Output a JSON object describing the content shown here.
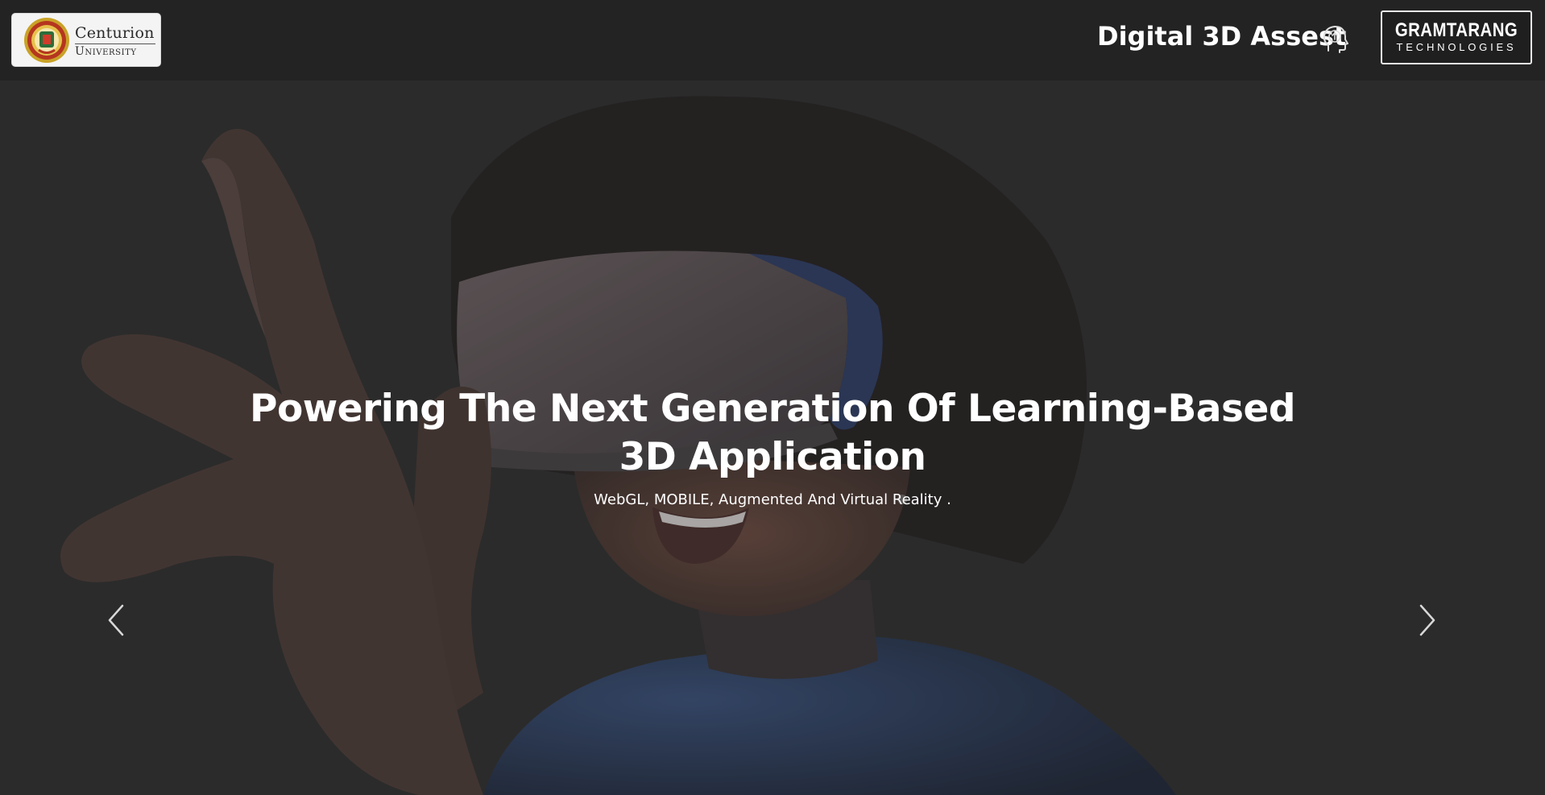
{
  "header": {
    "left_logo": {
      "name_line1": "Centurion",
      "name_line2": "University"
    },
    "site_title": "Digital 3D Assest",
    "title_icon": "head-upload-icon",
    "right_logo": {
      "name_line1": "GRAMTARANG",
      "name_line2": "TECHNOLOGIES"
    }
  },
  "hero": {
    "title": "Powering The Next Generation Of Learning-Based 3D Application",
    "subtitle": "WebGL, MOBILE, Augmented And Virtual Reality .",
    "prev_icon": "chevron-left-icon",
    "next_icon": "chevron-right-icon"
  },
  "colors": {
    "header_bg": "#232323",
    "hero_bg": "#2e2e2e",
    "text": "#ffffff"
  }
}
